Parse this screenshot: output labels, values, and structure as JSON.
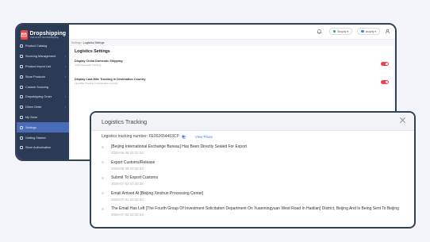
{
  "app": {
    "brand": "Dropshipping",
    "brand_sub": "Trust Us For Your Dropshipping",
    "colors": {
      "sidebar": "#2b3a55",
      "active": "#4a6bb8",
      "accent": "#e8454b",
      "link": "#3b82f6"
    }
  },
  "sidebar": {
    "items": [
      {
        "label": "Product Catalog",
        "icon": "grid-icon",
        "caret": ""
      },
      {
        "label": "Sourcing Management",
        "icon": "box-icon",
        "caret": "›"
      },
      {
        "label": "Product Import List",
        "icon": "list-icon",
        "caret": "›"
      },
      {
        "label": "Store Products",
        "icon": "store-icon",
        "caret": "›"
      },
      {
        "label": "Custom Sourcing",
        "icon": "search-icon",
        "caret": ""
      },
      {
        "label": "Dropshipping Order",
        "icon": "cart-icon",
        "caret": "›"
      },
      {
        "label": "Direct Order",
        "icon": "order-icon",
        "caret": "›"
      },
      {
        "label": "My Store",
        "icon": "shop-icon",
        "caret": ""
      },
      {
        "label": "Settings",
        "icon": "gear-icon",
        "caret": "",
        "active": true
      },
      {
        "label": "Getting Started",
        "icon": "flag-icon",
        "caret": ""
      },
      {
        "label": "Store Authorization",
        "icon": "link-icon",
        "caret": ""
      }
    ]
  },
  "topbar": {
    "store_label": "Shopify",
    "user_label": "shopify"
  },
  "breadcrumb": {
    "parent": "Settings",
    "separator": " / ",
    "current": "Logistics Settings"
  },
  "settings": {
    "title": "Logistics Settings",
    "items": [
      {
        "title": "Display China Domestic Shipping",
        "subtitle": "China Domestic Tracking",
        "enabled": true
      },
      {
        "title": "Display Last-Mile Tracking in Destination Country",
        "subtitle": "Last-Mile Tracking in Destination Country",
        "enabled": true
      }
    ]
  },
  "modal": {
    "title": "Logistics Tracking",
    "tracking_label": "Logistics tracking number:",
    "tracking_number": "FE002654463CP",
    "view_photo": "View Photo",
    "events": [
      {
        "text": "[Beijing International Exchange Bureau] Has Been Directly Sealed For Export",
        "time": "2025-06-28  22:32:34"
      },
      {
        "text": "Export Customs/Release",
        "time": "2025-06-29  22:32:34"
      },
      {
        "text": "Submit To Export Customs",
        "time": "2025-07-01  10:32:34"
      },
      {
        "text": "Email Arrived At [Beijing Xinshun Processing Center]",
        "time": "2025-07-01  22:32:34"
      },
      {
        "text": "The Email Has Left [The Fourth Group Of Investment Solicitation Department On Yuanmingyuan West Road In Haidian] District, Beijing And Is Being Sent To Beijing",
        "time": "2025-07-02  22:32:34"
      }
    ]
  }
}
